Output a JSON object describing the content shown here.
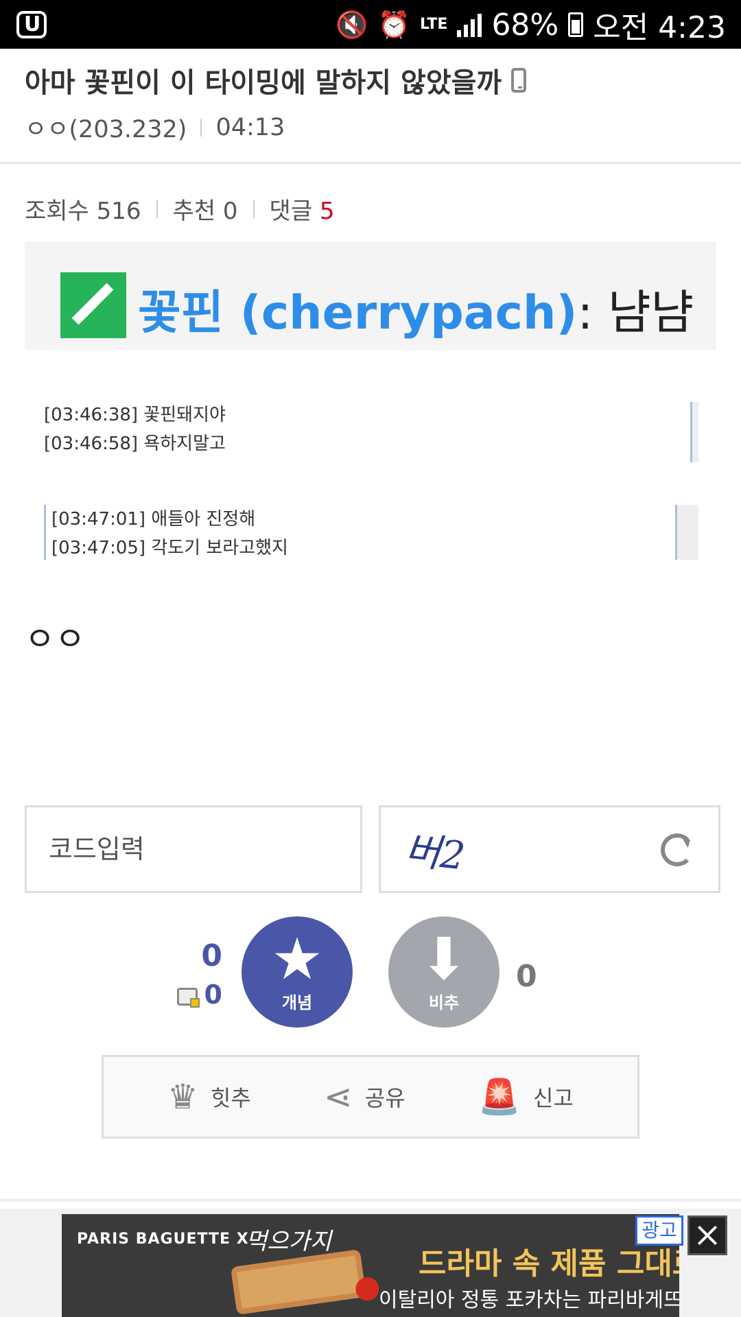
{
  "status_bar": {
    "battery": "68%",
    "time": "오전 4:23",
    "network": "LTE"
  },
  "post": {
    "title": "아마 꽃핀이 이 타이밍에 말하지 않았을까",
    "author": "ㅇㅇ(203.232)",
    "time": "04:13",
    "views_label": "조회수 516",
    "recommend_label": "추천 0",
    "comments_label": "댓글",
    "comments_count": "5"
  },
  "content": {
    "banner_name": "꽃핀 (cherrypach)",
    "banner_message": ": 냠냠",
    "chat_block_1": [
      "[03:46:38] 꽃핀돼지야",
      "[03:46:58] 욕하지말고"
    ],
    "chat_block_2": [
      "[03:47:01] 애들아 진정해",
      "[03:47:05] 각도기 보라고했지"
    ],
    "body": "ㅇㅇ"
  },
  "captcha": {
    "placeholder": "코드입력",
    "captcha_text": "버2"
  },
  "vote": {
    "up_count": "0",
    "fixed_up_count": "0",
    "up_label": "개념",
    "down_label": "비추",
    "down_count": "0"
  },
  "actions": {
    "hit_label": "힛추",
    "share_label": "공유",
    "report_label": "신고"
  },
  "ad": {
    "brand": "PARIS BAGUETTE  X",
    "logo": "먹으가지",
    "headline": "드라마 속 제품 그대로",
    "sub": "이탈리아 정통 포카차는 파리바게뜨",
    "badge": "광고"
  },
  "colors": {
    "accent": "#4a56a8",
    "comment_count": "#d0021b",
    "banner_name": "#2e8de8"
  }
}
